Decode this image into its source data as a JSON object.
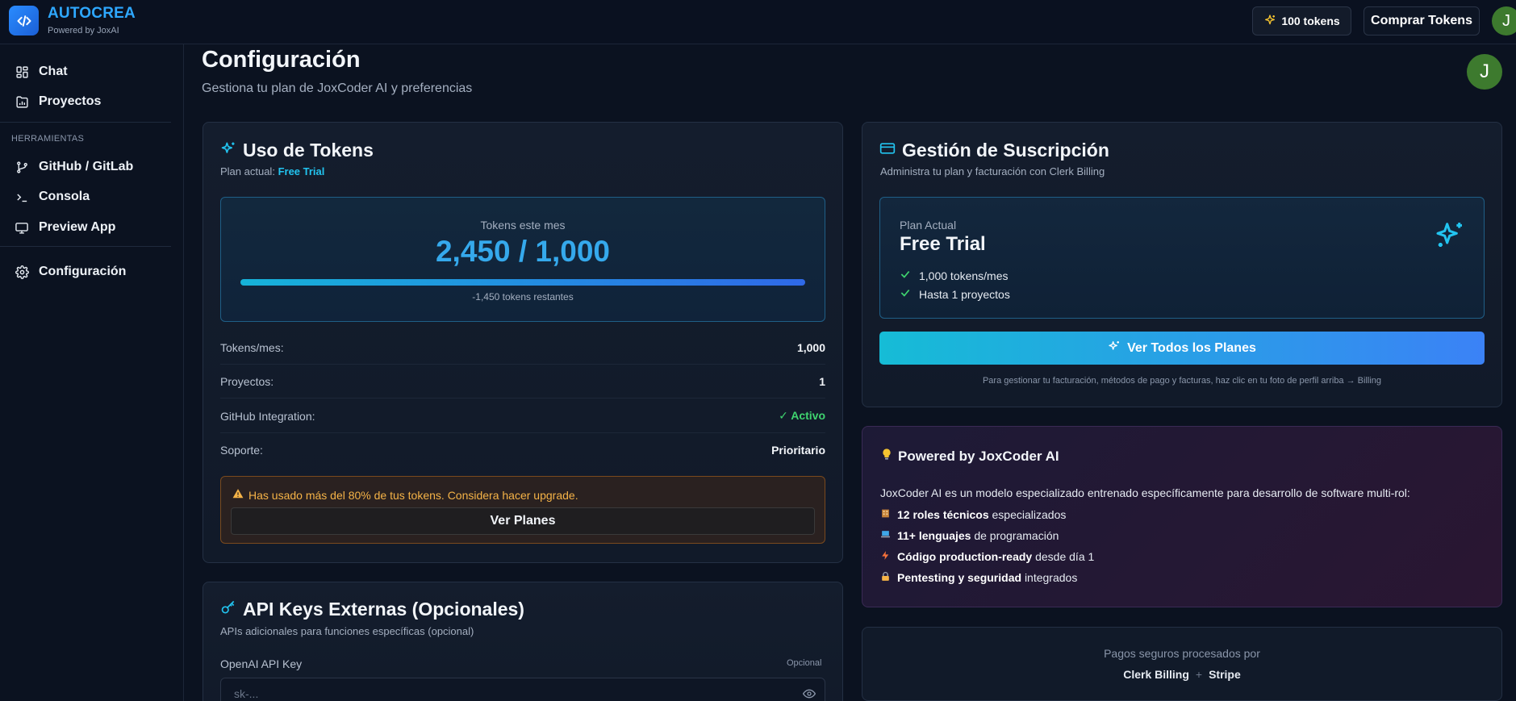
{
  "header": {
    "brand": "AUTOCREA",
    "tagline": "Powered by JoxAI",
    "tokens_badge": "100 tokens",
    "buy_button": "Comprar Tokens",
    "avatar_initial": "J"
  },
  "sidebar": {
    "items": [
      {
        "label": "Chat",
        "icon": "grid-icon"
      },
      {
        "label": "Proyectos",
        "icon": "folder-chart-icon"
      }
    ],
    "section_heading": "HERRAMIENTAS",
    "tools": [
      {
        "label": "GitHub / GitLab",
        "icon": "git-branch-icon"
      },
      {
        "label": "Consola",
        "icon": "terminal-icon"
      },
      {
        "label": "Preview App",
        "icon": "monitor-icon"
      }
    ],
    "settings": {
      "label": "Configuración",
      "icon": "gear-icon"
    }
  },
  "page": {
    "title": "Configuración",
    "subtitle": "Gestiona tu plan de JoxCoder AI y preferencias",
    "avatar_initial": "J"
  },
  "token_usage": {
    "title": "Uso de Tokens",
    "plan_prefix": "Plan actual:",
    "plan_name": "Free Trial",
    "usage_label": "Tokens este mes",
    "usage_value": "2,450 / 1,000",
    "progress": 1.0,
    "remaining": "-1,450 tokens restantes",
    "stats": [
      {
        "key": "Tokens/mes:",
        "value": "1,000"
      },
      {
        "key": "Proyectos:",
        "value": "1"
      },
      {
        "key": "GitHub Integration:",
        "value": "✓ Activo"
      },
      {
        "key": "Soporte:",
        "value": "Prioritario"
      }
    ],
    "warning": "Has usado más del 80% de tus tokens. Considera hacer upgrade.",
    "warning_button": "Ver Planes"
  },
  "api_keys": {
    "title": "API Keys Externas (Opcionales)",
    "subtitle": "APIs adicionales para funciones específicas (opcional)",
    "openai_label": "OpenAI API Key",
    "optional_tag": "Opcional",
    "openai_placeholder": "sk-..."
  },
  "subscription": {
    "title": "Gestión de Suscripción",
    "subtitle": "Administra tu plan y facturación con Clerk Billing",
    "plan_label": "Plan Actual",
    "plan_name": "Free Trial",
    "features": [
      "1,000 tokens/mes",
      "Hasta 1 proyectos"
    ],
    "button": "Ver Todos los Planes",
    "note": "Para gestionar tu facturación, métodos de pago y facturas, haz clic en tu foto de perfil arriba → Billing"
  },
  "powered": {
    "title": "Powered by JoxCoder AI",
    "description": "JoxCoder AI es un modelo especializado entrenado específicamente para desarrollo de software multi-rol:",
    "items": [
      {
        "bold": "12 roles técnicos",
        "rest": "especializados",
        "icon": "building-icon"
      },
      {
        "bold": "11+ lenguajes",
        "rest": "de programación",
        "icon": "laptop-icon"
      },
      {
        "bold": "Código production-ready",
        "rest": "desde día 1",
        "icon": "lightning-icon"
      },
      {
        "bold": "Pentesting y seguridad",
        "rest": "integrados",
        "icon": "lock-icon"
      }
    ]
  },
  "payments": {
    "text": "Pagos seguros procesados por",
    "brand_a": "Clerk Billing",
    "separator": "+",
    "brand_b": "Stripe"
  },
  "colors": {
    "accent": "#2ea8ff",
    "cyan": "#22c4f0",
    "success": "#3fd46f",
    "warning": "#f5b347",
    "background": "#0b1220"
  }
}
